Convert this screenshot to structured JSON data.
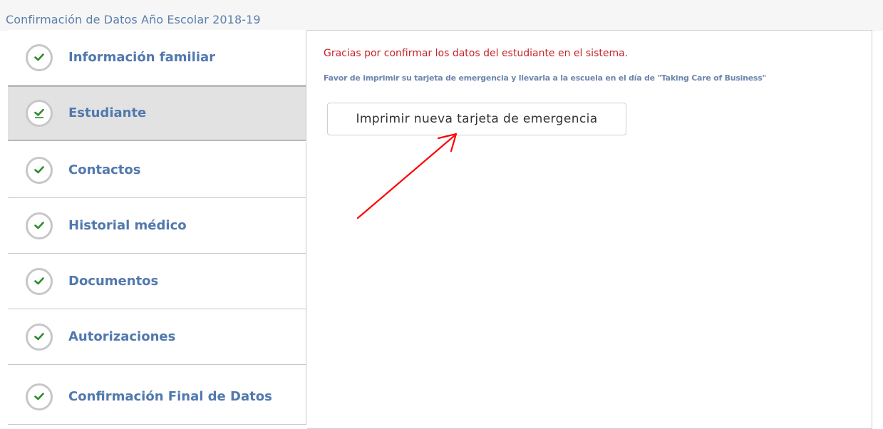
{
  "page": {
    "title": "Confirmación de Datos Año Escolar 2018-19"
  },
  "sidebar": {
    "steps": [
      {
        "label": "Información familiar",
        "icon": "check-circle-icon",
        "active": false
      },
      {
        "label": "Estudiante",
        "icon": "check-circle-icon",
        "active": true
      },
      {
        "label": "Contactos",
        "icon": "check-circle-icon",
        "active": false
      },
      {
        "label": "Historial médico",
        "icon": "check-circle-icon",
        "active": false
      },
      {
        "label": "Documentos",
        "icon": "check-circle-icon",
        "active": false
      },
      {
        "label": "Autorizaciones",
        "icon": "check-circle-icon",
        "active": false
      },
      {
        "label": "Confirmación Final de Datos",
        "icon": "check-circle-icon",
        "active": false
      }
    ]
  },
  "main": {
    "confirmation_message": "Gracias por confirmar los datos del estudiante en el sistema.",
    "print_instruction": "Favor de imprimir su tarjeta de emergencia y llevarla a la escuela en el día de \"Taking Care of Business\"",
    "print_button_label": "Imprimir nueva tarjeta de emergencia"
  },
  "colors": {
    "label_blue": "#5179ad",
    "message_red": "#c7232c",
    "check_green": "#2e8b2e",
    "annotation_arrow_red": "#ff0000",
    "active_step_bg": "#e2e2e2"
  }
}
